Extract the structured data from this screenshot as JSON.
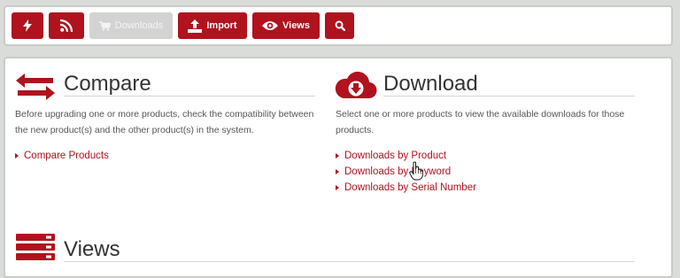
{
  "toolbar": {
    "buttons": [
      {
        "icon": "lightning-icon",
        "label": ""
      },
      {
        "icon": "rss-icon",
        "label": ""
      },
      {
        "icon": "cart-icon",
        "label": "Downloads",
        "disabled": true
      },
      {
        "icon": "upload-icon",
        "label": "Import"
      },
      {
        "icon": "eye-icon",
        "label": "Views"
      },
      {
        "icon": "search-icon",
        "label": ""
      }
    ]
  },
  "compare": {
    "icon": "swap-arrows-icon",
    "title": "Compare",
    "description": "Before upgrading one or more products, check the compatibility between the new product(s) and the other product(s) in the system.",
    "links": [
      "Compare Products"
    ]
  },
  "download": {
    "icon": "cloud-download-icon",
    "title": "Download",
    "description": "Select one or more products to view the available downloads for those products.",
    "links": [
      "Downloads by Product",
      "Downloads by Keyword",
      "Downloads by Serial Number"
    ]
  },
  "views": {
    "icon": "stacked-bars-icon",
    "title": "Views"
  },
  "colors": {
    "accent": "#b0121e",
    "disabled": "#d3d3d3",
    "background": "#d9dcd9"
  }
}
